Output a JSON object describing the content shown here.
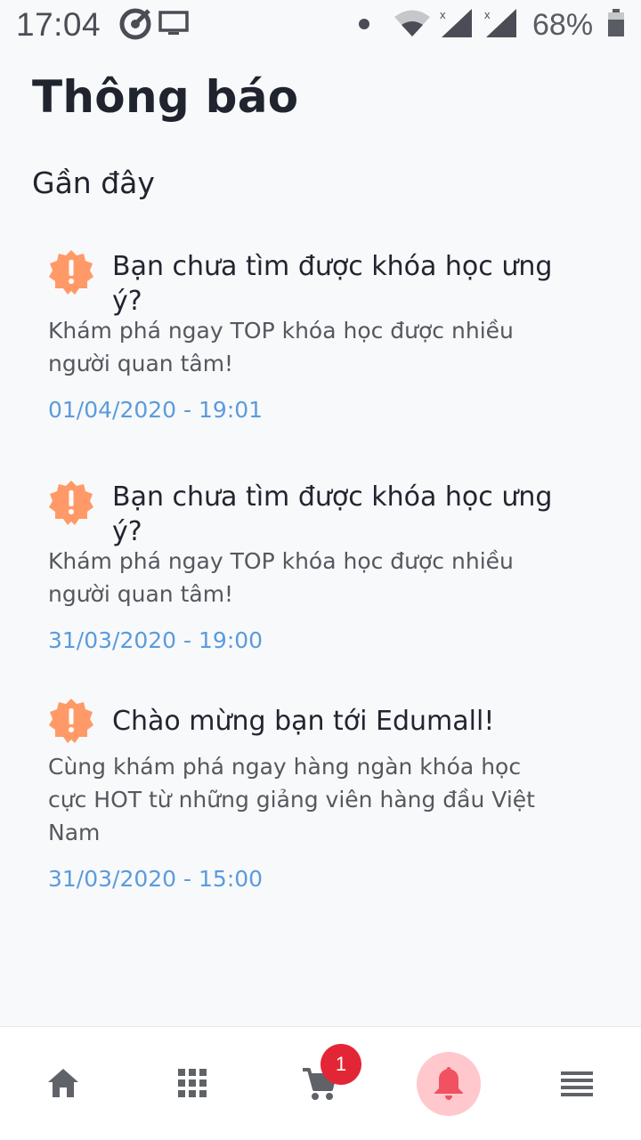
{
  "status_bar": {
    "time": "17:04",
    "battery": "68%",
    "icons": [
      "app-activity-icon",
      "screen-cast-icon",
      "dot-icon",
      "wifi-icon",
      "signal-icon",
      "signal-icon",
      "battery-icon"
    ]
  },
  "page": {
    "title": "Thông báo",
    "section": "Gần đây"
  },
  "notifications": [
    {
      "icon": "alert-badge-icon",
      "title": "Bạn chưa tìm được khóa học ưng ý?",
      "body": "Khám phá ngay TOP khóa học được nhiều người quan tâm!",
      "time": "01/04/2020 - 19:01"
    },
    {
      "icon": "alert-badge-icon",
      "title": "Bạn chưa tìm được khóa học ưng ý?",
      "body": "Khám phá ngay TOP khóa học được nhiều người quan tâm!",
      "time": "31/03/2020 - 19:00"
    },
    {
      "icon": "alert-badge-icon",
      "title": "Chào mừng bạn tới Edumall!",
      "body": "Cùng khám phá ngay hàng ngàn khóa học cực HOT từ những giảng viên hàng đầu Việt Nam",
      "time": "31/03/2020 - 15:00"
    }
  ],
  "bottom_nav": {
    "items": [
      "home-icon",
      "grid-icon",
      "cart-icon",
      "bell-icon",
      "menu-icon"
    ],
    "active": "bell-icon",
    "cart_badge": "1"
  },
  "colors": {
    "accent_alert": "#ff9a68",
    "time_blue": "#5b9bdc",
    "active_bell": "#f05262",
    "badge_red": "#e32636"
  }
}
